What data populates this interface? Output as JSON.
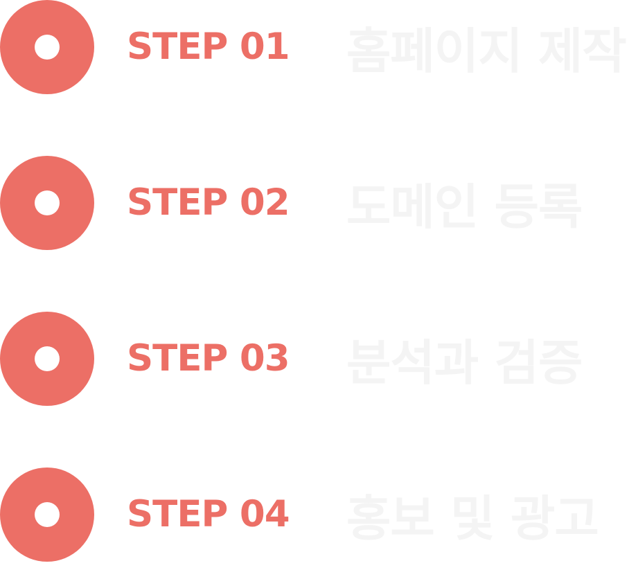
{
  "colors": {
    "accent": "#ec6f66",
    "title": "#f4f4f4",
    "background": "#ffffff"
  },
  "steps": [
    {
      "label": "STEP 01",
      "title": "홈페이지 제작"
    },
    {
      "label": "STEP 02",
      "title": "도메인 등록"
    },
    {
      "label": "STEP 03",
      "title": "분석과 검증"
    },
    {
      "label": "STEP 04",
      "title": "홍보 및 광고"
    }
  ]
}
